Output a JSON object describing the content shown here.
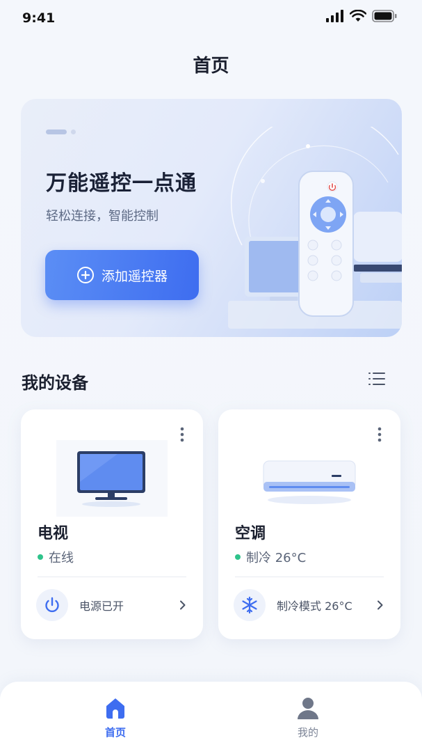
{
  "status_bar": {
    "time": "9:41"
  },
  "header": {
    "title": "首页"
  },
  "banner": {
    "title": "万能遥控一点通",
    "subtitle": "轻松连接，智能控制",
    "add_button_label": "添加遥控器"
  },
  "devices_section": {
    "title": "我的设备"
  },
  "devices": [
    {
      "name": "电视",
      "status": "在线",
      "action_label": "电源已开",
      "action_icon": "power-icon",
      "image": "tv"
    },
    {
      "name": "空调",
      "status": "制冷 26°C",
      "action_label": "制冷模式 26°C",
      "action_icon": "snowflake-icon",
      "image": "air-conditioner"
    }
  ],
  "tab_bar": {
    "tabs": [
      {
        "label": "首页",
        "icon": "home-icon",
        "active": true
      },
      {
        "label": "我的",
        "icon": "user-icon",
        "active": false
      }
    ]
  },
  "colors": {
    "accent": "#3e6df0",
    "online": "#2fc38b",
    "background": "#f4f7fc"
  }
}
